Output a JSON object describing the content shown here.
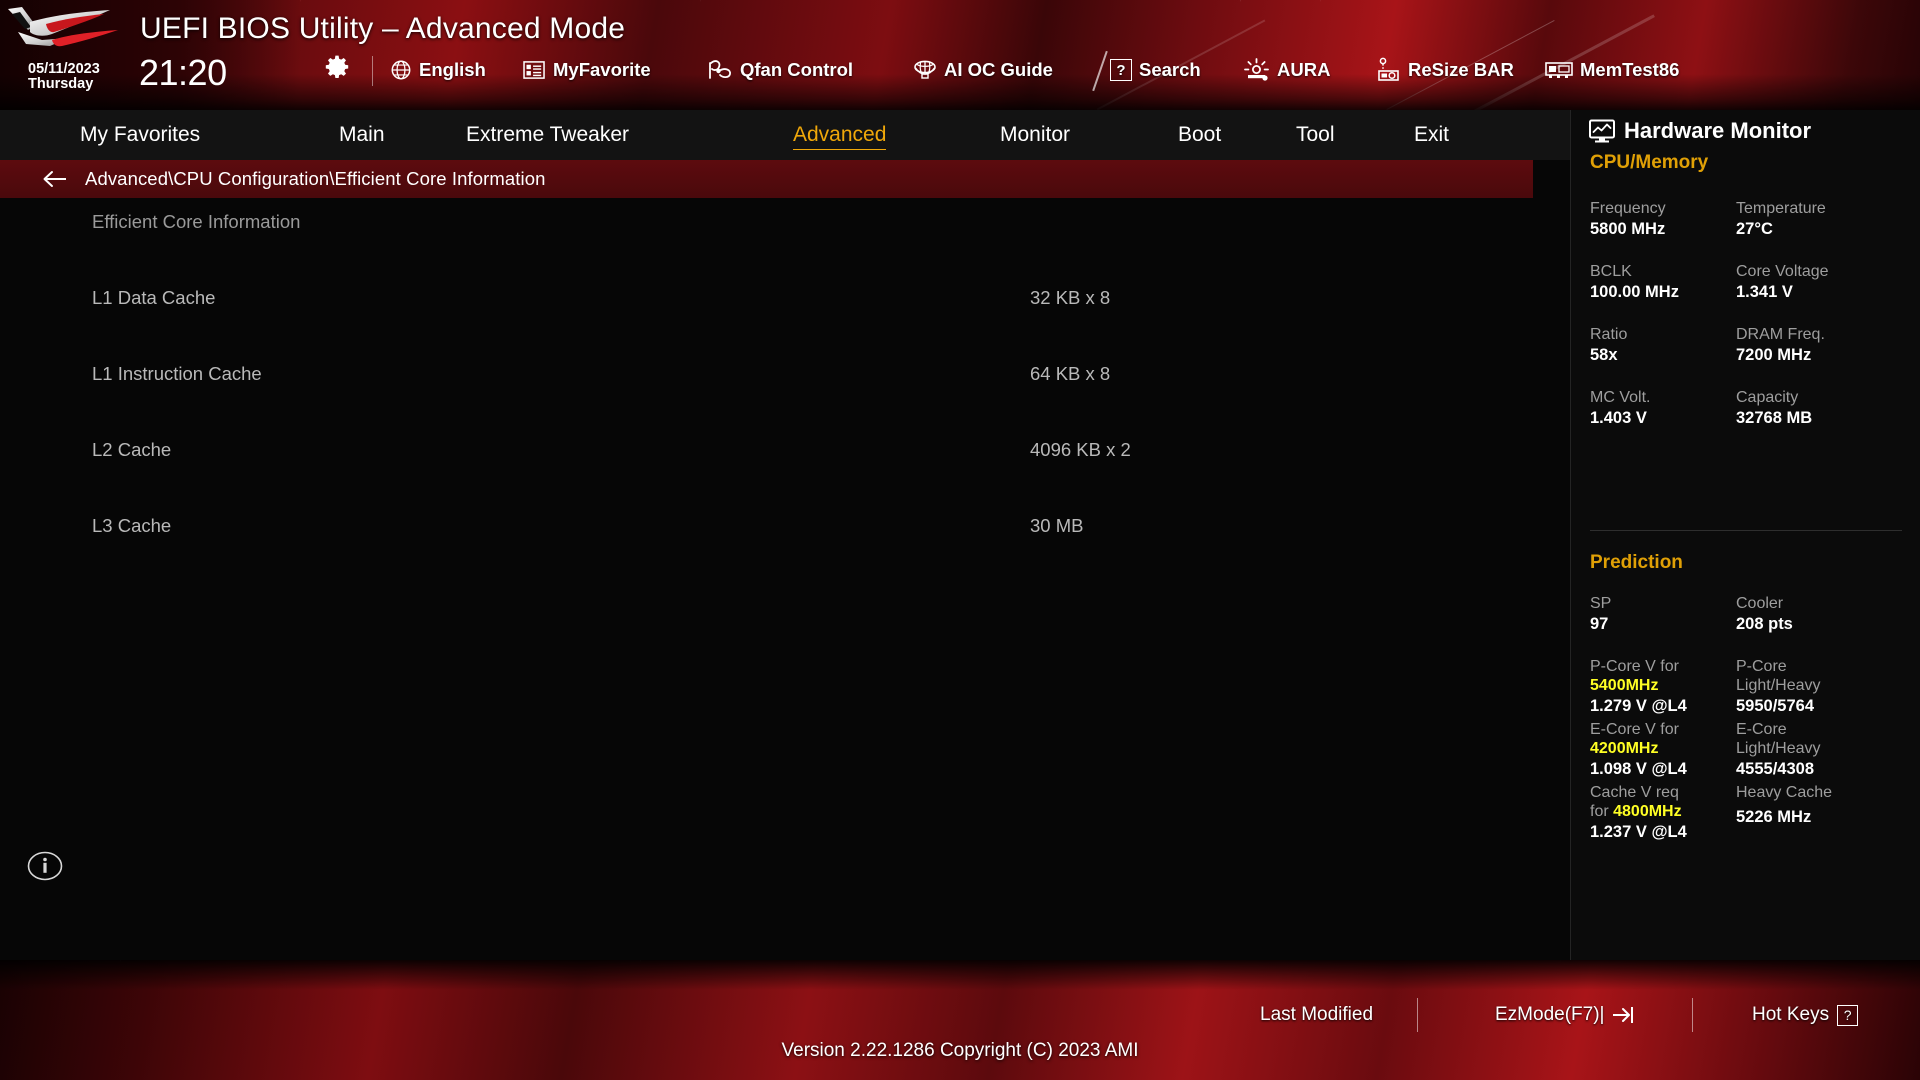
{
  "header": {
    "title": "UEFI BIOS Utility – Advanced Mode",
    "date": "05/11/2023",
    "weekday": "Thursday",
    "time": "21:20",
    "gear_icon": "gear-icon",
    "tools": [
      {
        "label": "English",
        "icon": "globe-icon"
      },
      {
        "label": "MyFavorite",
        "icon": "list-icon"
      },
      {
        "label": "Qfan Control",
        "icon": "fan-icon"
      },
      {
        "label": "AI OC Guide",
        "icon": "brain-icon"
      },
      {
        "label": "Search",
        "icon": "question-box-icon"
      },
      {
        "label": "AURA",
        "icon": "aura-icon"
      },
      {
        "label": "ReSize BAR",
        "icon": "gpu-icon"
      },
      {
        "label": "MemTest86",
        "icon": "memory-icon"
      }
    ]
  },
  "menu": {
    "tabs": [
      {
        "label": "My Favorites",
        "active": false
      },
      {
        "label": "Main",
        "active": false
      },
      {
        "label": "Extreme Tweaker",
        "active": false
      },
      {
        "label": "Advanced",
        "active": true
      },
      {
        "label": "Monitor",
        "active": false
      },
      {
        "label": "Boot",
        "active": false
      },
      {
        "label": "Tool",
        "active": false
      },
      {
        "label": "Exit",
        "active": false
      }
    ],
    "active_color": "#f0a80a"
  },
  "breadcrumb": {
    "back_icon": "back-arrow-icon",
    "path": "Advanced\\CPU Configuration\\Efficient Core Information"
  },
  "main": {
    "section_title": "Efficient Core Information",
    "rows": [
      {
        "label": "L1 Data Cache",
        "value": "32 KB x 8"
      },
      {
        "label": "L1 Instruction Cache",
        "value": "64 KB x 8"
      },
      {
        "label": "L2 Cache",
        "value": "4096 KB x 2"
      },
      {
        "label": "L3 Cache",
        "value": "30 MB"
      }
    ],
    "info_icon": "info-circle-icon"
  },
  "sidebar": {
    "title": "Hardware Monitor",
    "title_icon": "monitor-graph-icon",
    "sections": [
      {
        "name": "CPU/Memory",
        "color": "#e0a006",
        "pairs": [
          {
            "key": "Frequency",
            "value": "5800 MHz",
            "key2": "Temperature",
            "value2": "27°C"
          },
          {
            "key": "BCLK",
            "value": "100.00 MHz",
            "key2": "Core Voltage",
            "value2": "1.341 V"
          },
          {
            "key": "Ratio",
            "value": "58x",
            "key2": "DRAM Freq.",
            "value2": "7200 MHz"
          },
          {
            "key": "MC Volt.",
            "value": "1.403 V",
            "key2": "Capacity",
            "value2": "32768 MB"
          }
        ]
      },
      {
        "name": "Prediction",
        "color": "#e0a006",
        "pairs": [
          {
            "key": "SP",
            "value": "97",
            "key2": "Cooler",
            "value2": "208 pts"
          }
        ],
        "predictions": [
          {
            "key_pre": "P-Core V for",
            "key_hi": "5400MHz",
            "value": "1.279 V @L4",
            "key2_l1": "P-Core",
            "key2_l2": "Light/Heavy",
            "value2": "5950/5764"
          },
          {
            "key_pre": "E-Core V for",
            "key_hi": "4200MHz",
            "value": "1.098 V @L4",
            "key2_l1": "E-Core",
            "key2_l2": "Light/Heavy",
            "value2": "4555/4308"
          },
          {
            "key_pre": "Cache V req",
            "key_pre2": "for ",
            "key_hi": "4800MHz",
            "value": "1.237 V @L4",
            "key2_l1": "Heavy Cache",
            "key2_l2": "",
            "value2": "5226 MHz"
          }
        ],
        "highlight_color": "#ffff24"
      }
    ]
  },
  "footer": {
    "items": [
      {
        "label": "Last Modified",
        "icon": ""
      },
      {
        "label": "EzMode(F7)|",
        "icon": "exit-arrow-icon"
      },
      {
        "label": "Hot Keys",
        "icon": "question-key-icon"
      }
    ],
    "version": "Version 2.22.1286 Copyright (C) 2023 AMI"
  }
}
